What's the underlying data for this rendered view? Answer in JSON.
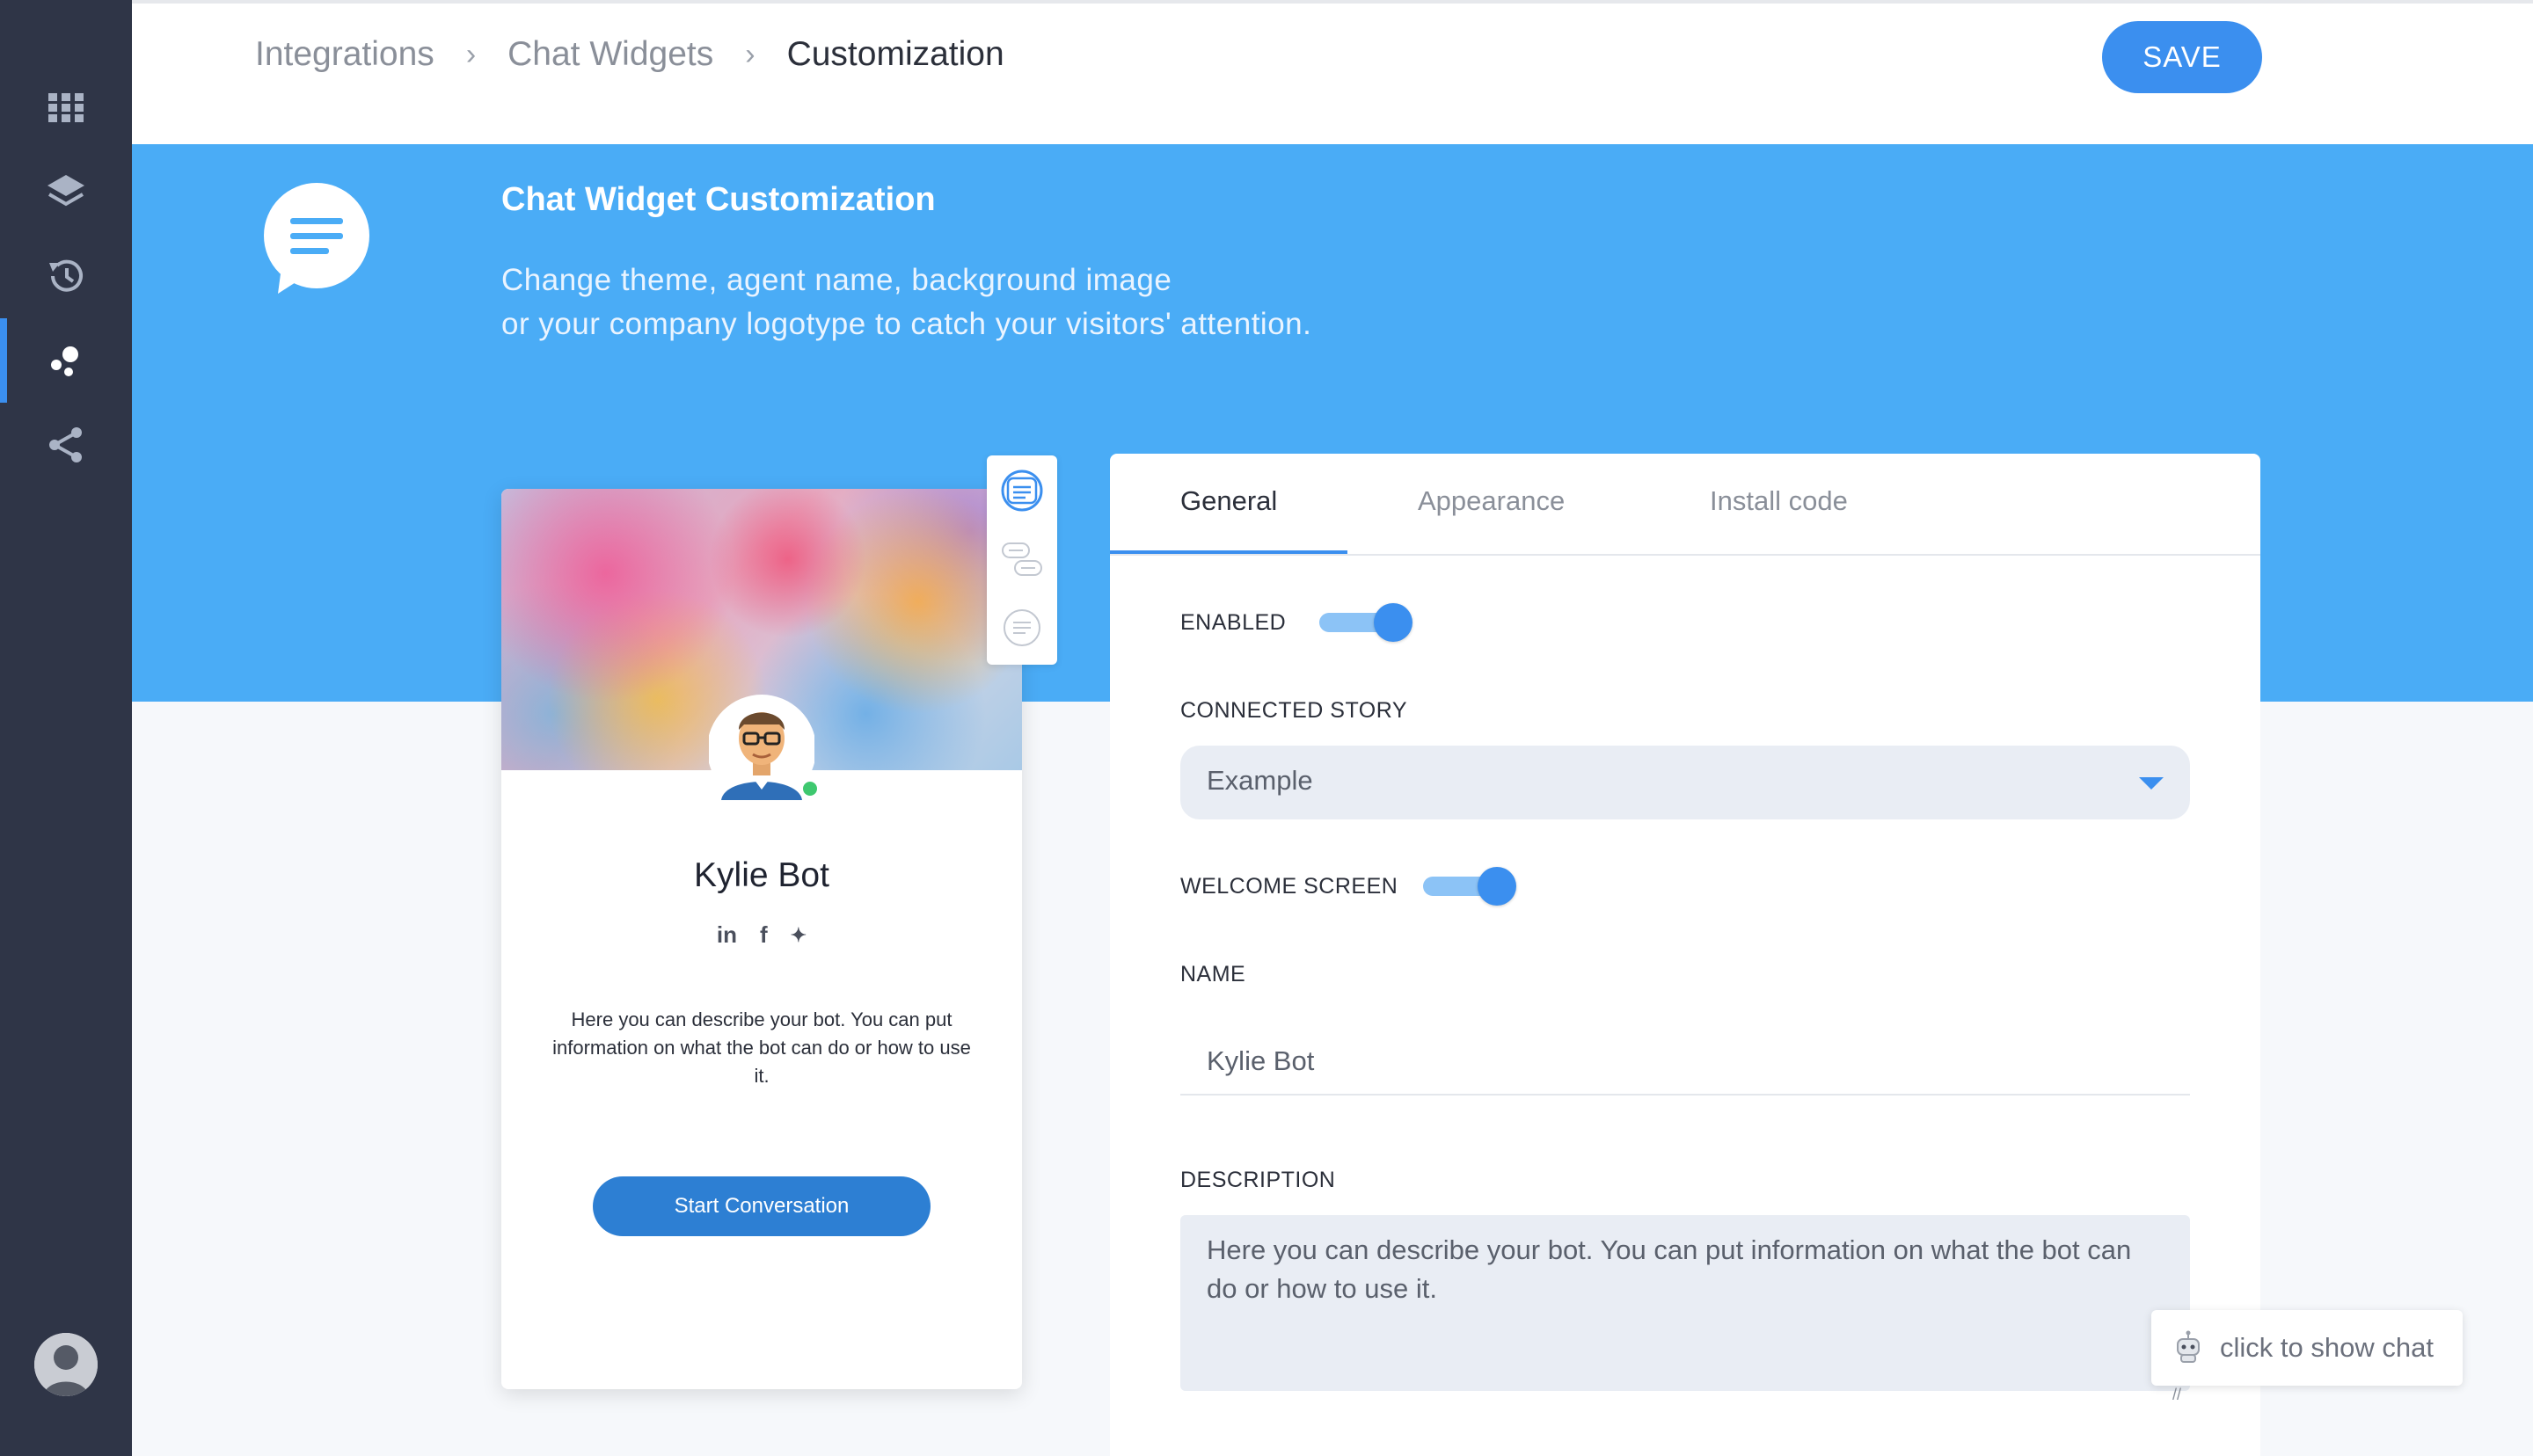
{
  "sidebar": {
    "items": [
      {
        "icon": "grid-icon"
      },
      {
        "icon": "layers-icon"
      },
      {
        "icon": "history-icon"
      },
      {
        "icon": "bubbles-icon",
        "active": true
      },
      {
        "icon": "share-icon"
      }
    ],
    "avatar_icon": "user-avatar-icon"
  },
  "breadcrumb": {
    "items": [
      "Integrations",
      "Chat Widgets",
      "Customization"
    ],
    "separator": ">"
  },
  "toolbar": {
    "save_label": "SAVE"
  },
  "hero": {
    "icon": "chat-bubble-icon",
    "title": "Chat Widget Customization",
    "description_line1": "Change theme, agent name, background image",
    "description_line2": "or your company logotype to catch your visitors' attention."
  },
  "preview": {
    "bot_name": "Kylie Bot",
    "socials": {
      "linkedin": "in",
      "facebook": "f",
      "twitter": "✦"
    },
    "description": "Here you can describe your bot. You can put information on what the bot can do or how to use it.",
    "start_label": "Start Conversation",
    "status": "online"
  },
  "layout_switch": {
    "options": [
      "layout-full-icon",
      "layout-bubbles-icon",
      "layout-single-bubble-icon"
    ],
    "selected": 0
  },
  "panel": {
    "tabs": [
      {
        "label": "General",
        "active": true
      },
      {
        "label": "Appearance",
        "active": false
      },
      {
        "label": "Install code",
        "active": false
      }
    ],
    "enabled": {
      "label": "ENABLED",
      "value": true
    },
    "connected_story": {
      "label": "CONNECTED STORY",
      "value": "Example"
    },
    "welcome_screen": {
      "label": "WELCOME SCREEN",
      "value": true
    },
    "name": {
      "label": "NAME",
      "value": "Kylie Bot"
    },
    "description": {
      "label": "DESCRIPTION",
      "value": "Here you can describe your bot. You can put information on what the bot can do or how to use it."
    }
  },
  "chat_launcher": {
    "label": "click to show chat"
  },
  "colors": {
    "accent": "#3b8fef",
    "hero": "#4aacf6",
    "sidebar": "#2f3547"
  }
}
